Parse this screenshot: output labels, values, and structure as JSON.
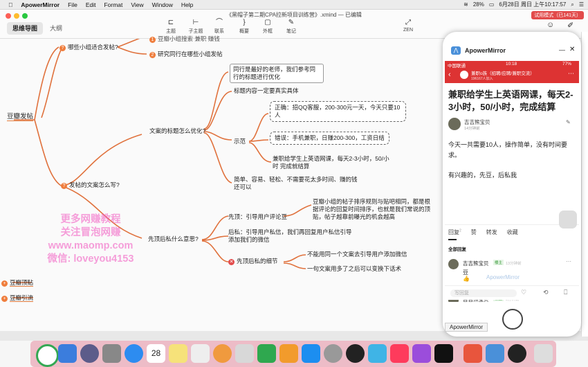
{
  "menubar": {
    "app": "ApowerMirror",
    "items": [
      "File",
      "Edit",
      "Format",
      "View",
      "Window",
      "Help"
    ],
    "battery": "28%",
    "datetime": "6月28日 周日 上午10:17:57"
  },
  "toolbar": {
    "doc_title": "《黑帽子第二期CPA拉新项目训练营》.xmind — 已编辑",
    "tabs": [
      "思维导图",
      "大纲"
    ],
    "buttons": [
      "主题",
      "子主题",
      "联系",
      "概要",
      "外框",
      "笔记"
    ],
    "zen": "ZEN",
    "trial": "试用模式（已141天）"
  },
  "mindmap": {
    "root1": "豆瓣发帖",
    "q1": "哪些小组适合发帖?",
    "top_cut": "豆瓣小组搜索 兼职 赚钱",
    "q2": "研究同行在哪些小组发帖",
    "how": "发帖的文案怎么写?",
    "title_opt": "文案的标题怎么优化?",
    "t1": "同行是最好的老师，我们参考同行的标题进行优化",
    "t2": "标题内容一定要真实具体",
    "demo": "示范",
    "correct": "正确：招QQ客服，200-300元一天，今天只要10人",
    "wrong": "错误：手机兼职，日赚200-300，工资日结",
    "ex3": "兼职给学生上英语网课，每天2-3小时，50/小时 完成就结算",
    "simple": "简单、容易、轻松、不需要花太多时间、赚的钱还可以",
    "first_top": "先顶后私什么意思?",
    "ding": "先顶：引导用户评论豆",
    "ding_desc": "豆瓣小组的帖子排序规则与贴吧相同，都是根据评论的回复时间排序，也就是我们常说的顶贴，帖子越靠前曝光的机会越高",
    "si": "后私：引导用户私信，我们再回复用户私信引导添加我们的微信",
    "detail": "先顶后私的细节",
    "d1": "不能用同一个文案去引导用户添加微信",
    "d2": "一句文案用多了之后可以变换下话术",
    "root2": "豆瓣顶贴",
    "root3": "豆瓣引流",
    "watermark": [
      "更多网赚教程",
      "关注冒泡网赚",
      "www.maomp.com",
      "微信: loveyou4153"
    ]
  },
  "phone": {
    "app_title": "ApowerMirror",
    "carrier": "中国联通",
    "time": "10:18",
    "battery": "77%",
    "group": "兼职o族（招聘/应聘/兼职交流）",
    "group_sub": "196167人加入",
    "post_title": "兼职给学生上英语网课，每天2-3小时，50/小时，完成结算",
    "author": "吉吉熊宝贝",
    "author_time": "14分钟前",
    "body1": "今天一共需要10人，操作简单，没有时间要求。",
    "body2": "有兴趣的，先豆，后私我",
    "tabs": [
      "回复",
      "赞",
      "转发",
      "收藏"
    ],
    "reply_count": "2",
    "all_replies": "全部回复",
    "reply_user": "吉吉熊宝贝",
    "reply_tag": "楼主",
    "reply_time1": "13分钟前",
    "reply_time2": "8分钟前",
    "reply_text": "豆",
    "input_placeholder": "写回复",
    "watermark": "ApowerMirror",
    "tooltip": "ApowerMirror"
  },
  "colors": {
    "branch": "#e0713c",
    "accent": "#d33333",
    "badge": "#ef7d3c"
  }
}
